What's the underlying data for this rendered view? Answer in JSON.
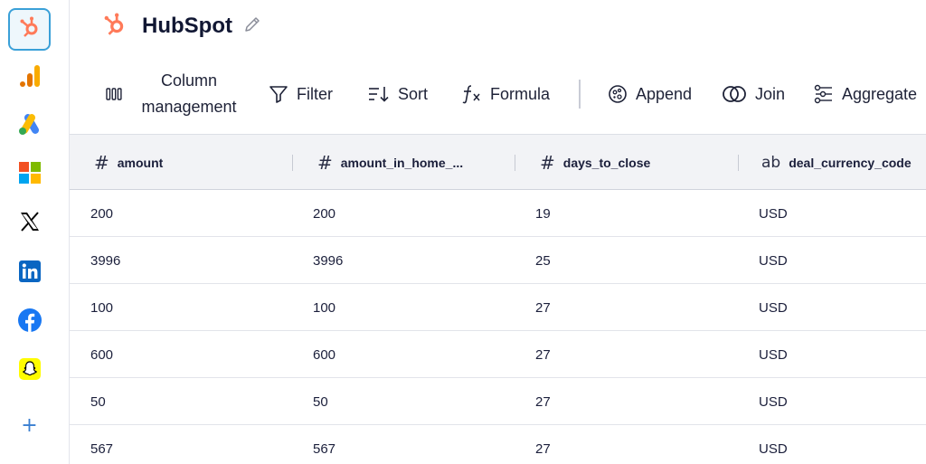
{
  "app": {
    "title": "HubSpot"
  },
  "sources": [
    {
      "name": "hubspot-icon",
      "color": "#ff7a59"
    },
    {
      "name": "google-analytics-icon",
      "color": "#f9ab00"
    },
    {
      "name": "google-ads-icon",
      "color": "#4285f4"
    },
    {
      "name": "microsoft-icon",
      "color": "#f25022"
    },
    {
      "name": "x-icon",
      "color": "#000000"
    },
    {
      "name": "linkedin-icon",
      "color": "#0a66c2"
    },
    {
      "name": "facebook-icon",
      "color": "#1877f2"
    },
    {
      "name": "snapchat-icon",
      "color": "#fffc00"
    }
  ],
  "add_label": "+",
  "toolbar": {
    "column_management": "Column management",
    "filter": "Filter",
    "sort": "Sort",
    "formula": "Formula",
    "append": "Append",
    "join": "Join",
    "aggregate": "Aggregate"
  },
  "table": {
    "columns": [
      {
        "type": "#",
        "name": "amount"
      },
      {
        "type": "#",
        "name": "amount_in_home_..."
      },
      {
        "type": "#",
        "name": "days_to_close"
      },
      {
        "type": "ab",
        "name": "deal_currency_code"
      }
    ],
    "rows": [
      [
        "200",
        "200",
        "19",
        "USD"
      ],
      [
        "3996",
        "3996",
        "25",
        "USD"
      ],
      [
        "100",
        "100",
        "27",
        "USD"
      ],
      [
        "600",
        "600",
        "27",
        "USD"
      ],
      [
        "50",
        "50",
        "27",
        "USD"
      ],
      [
        "567",
        "567",
        "27",
        "USD"
      ]
    ]
  }
}
